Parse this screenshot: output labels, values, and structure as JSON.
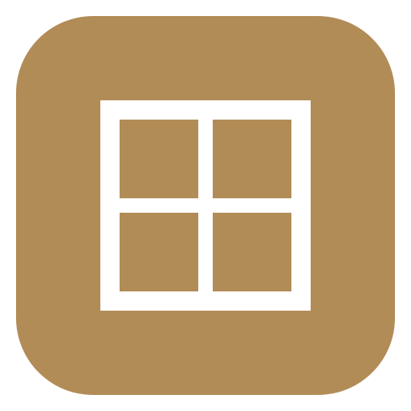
{
  "app_icon": {
    "name": "grid-window-app",
    "background_color": "#B28C57",
    "glyph_color": "#FFFFFF",
    "glyph": "grid-window-icon"
  }
}
